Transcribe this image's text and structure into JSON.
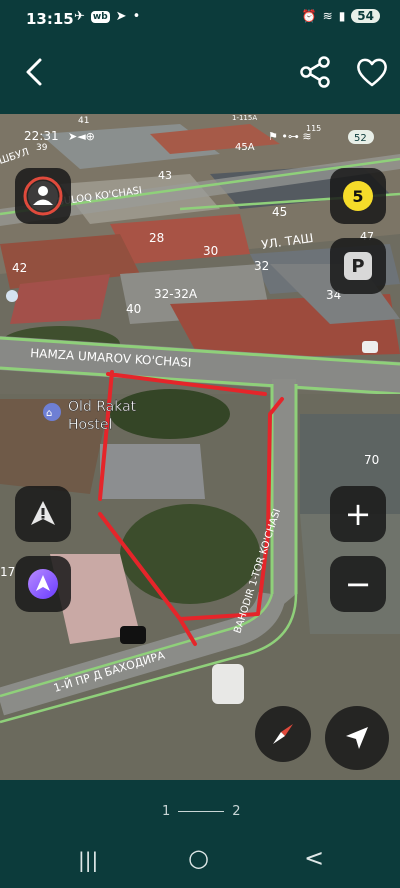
{
  "status": {
    "time": "13:15",
    "battery": "54",
    "wb": "wb"
  },
  "map": {
    "inner_status_time": "22:31",
    "inner_battery": "52",
    "streets": {
      "hamza": "HAMZA UMAROV KO'CHASI",
      "toshbuloq": "TOSHBULOQ KO'CHASI",
      "tash": "УЛ. ТАШ",
      "shbul": "ШБУЛ",
      "bahodir1": "1-Й ПР Д БАХОДИРА",
      "bahodir2": "BAHODIR 1-TOR KO'CHASI"
    },
    "house_numbers": [
      "41",
      "39",
      "45A",
      "43",
      "45",
      "28",
      "30",
      "32",
      "42",
      "32-32A",
      "34",
      "40",
      "47",
      "70",
      "17",
      "115",
      "1-115A"
    ],
    "poi_label_1": "Old Rakat",
    "poi_label_2": "Hostel",
    "badge_level": "5",
    "parking_label": "P",
    "zoom_in": "+",
    "zoom_out": "−"
  },
  "pager": {
    "current": "1",
    "next": "2"
  },
  "nav": {
    "recents": "|||",
    "home": "○",
    "back": "<"
  }
}
